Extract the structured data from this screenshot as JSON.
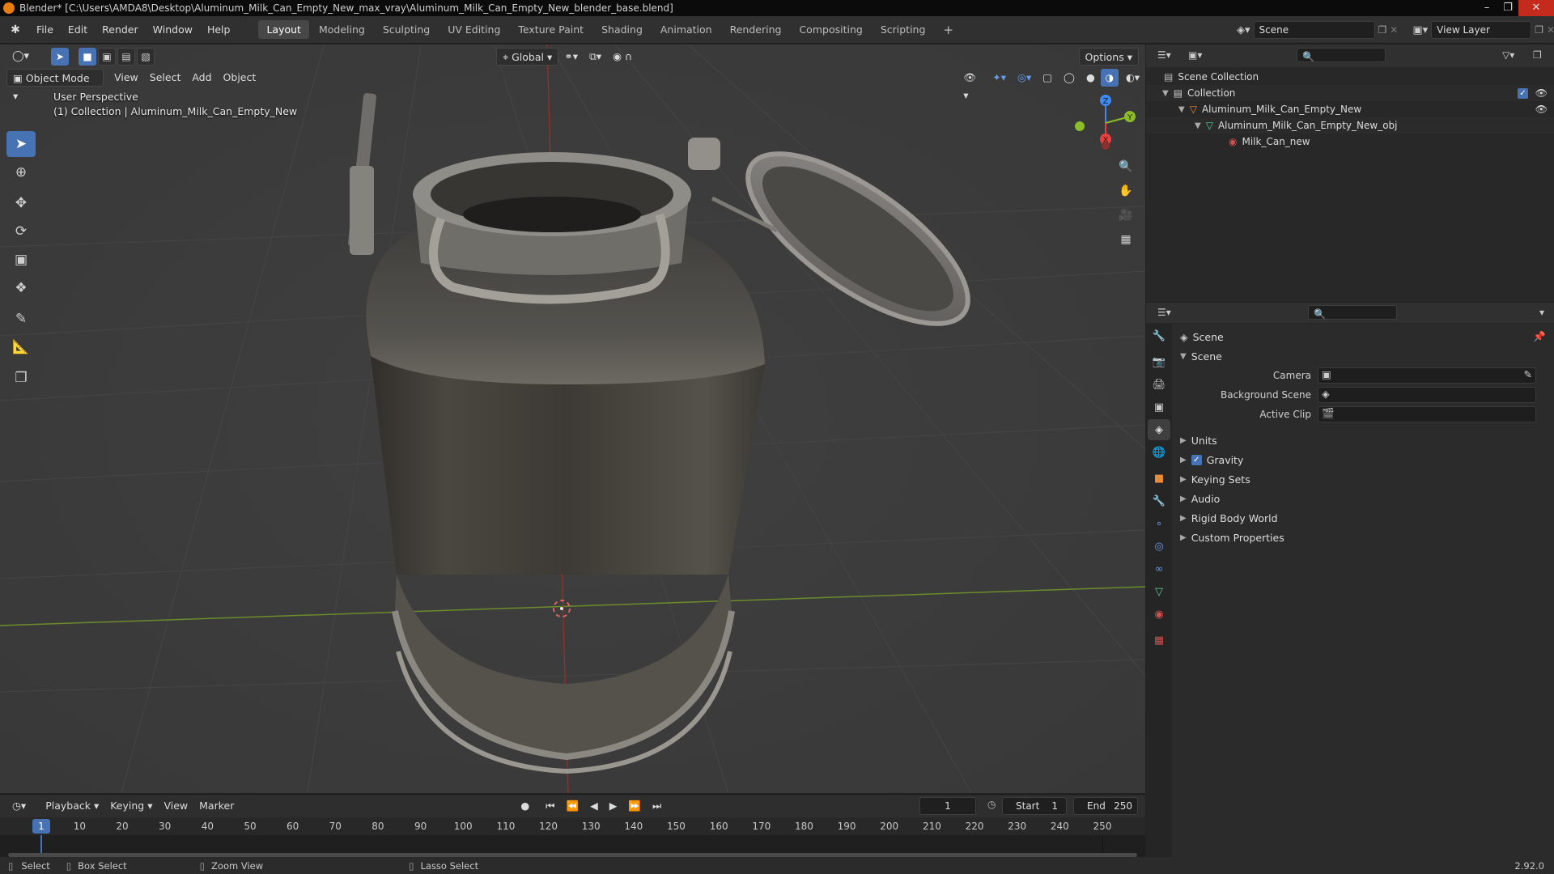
{
  "title_bar": {
    "text": "Blender* [C:\\Users\\AMDA8\\Desktop\\Aluminum_Milk_Can_Empty_New_max_vray\\Aluminum_Milk_Can_Empty_New_blender_base.blend]"
  },
  "menu": [
    "File",
    "Edit",
    "Render",
    "Window",
    "Help"
  ],
  "workspaces": [
    "Layout",
    "Modeling",
    "Sculpting",
    "UV Editing",
    "Texture Paint",
    "Shading",
    "Animation",
    "Rendering",
    "Compositing",
    "Scripting"
  ],
  "active_workspace": "Layout",
  "add_workspace": "+",
  "scene_name": "Scene",
  "view_layer": "View Layer",
  "viewport": {
    "mode": "Object Mode",
    "menus": [
      "View",
      "Select",
      "Add",
      "Object"
    ],
    "orientation": "Global",
    "options": "Options",
    "info_line1": "User Perspective",
    "info_line2": "(1) Collection | Aluminum_Milk_Can_Empty_New",
    "gizmo_axes": {
      "z": "Z",
      "y": "Y",
      "x": "X"
    }
  },
  "timeline": {
    "menus": [
      "Playback",
      "Keying",
      "View",
      "Marker"
    ],
    "current_frame": "1",
    "start_label": "Start",
    "start_value": "1",
    "end_label": "End",
    "end_value": "250",
    "ruler_current": "1",
    "ruler_ticks": [
      "10",
      "20",
      "30",
      "40",
      "50",
      "60",
      "70",
      "80",
      "90",
      "100",
      "110",
      "120",
      "130",
      "140",
      "150",
      "160",
      "170",
      "180",
      "190",
      "200",
      "210",
      "220",
      "230",
      "240",
      "250"
    ]
  },
  "status_bar": {
    "select": "Select",
    "box_select": "Box Select",
    "zoom_view": "Zoom View",
    "lasso_select": "Lasso Select",
    "version": "2.92.0"
  },
  "outliner": {
    "root": "Scene Collection",
    "collection": "Collection",
    "object": "Aluminum_Milk_Can_Empty_New",
    "mesh": "Aluminum_Milk_Can_Empty_New_obj",
    "material": "Milk_Can_new"
  },
  "properties": {
    "context": "Scene",
    "panel": "Scene",
    "camera_label": "Camera",
    "background_scene_label": "Background Scene",
    "active_clip_label": "Active Clip",
    "sections": [
      "Units",
      "Gravity",
      "Keying Sets",
      "Audio",
      "Rigid Body World",
      "Custom Properties"
    ],
    "gravity_checked": true
  },
  "colors": {
    "accent": "#4772b3",
    "x_axis": "#e8403f",
    "y_axis": "#8cbc27",
    "z_axis": "#3f8af0",
    "cursor": "#e87d0d"
  }
}
